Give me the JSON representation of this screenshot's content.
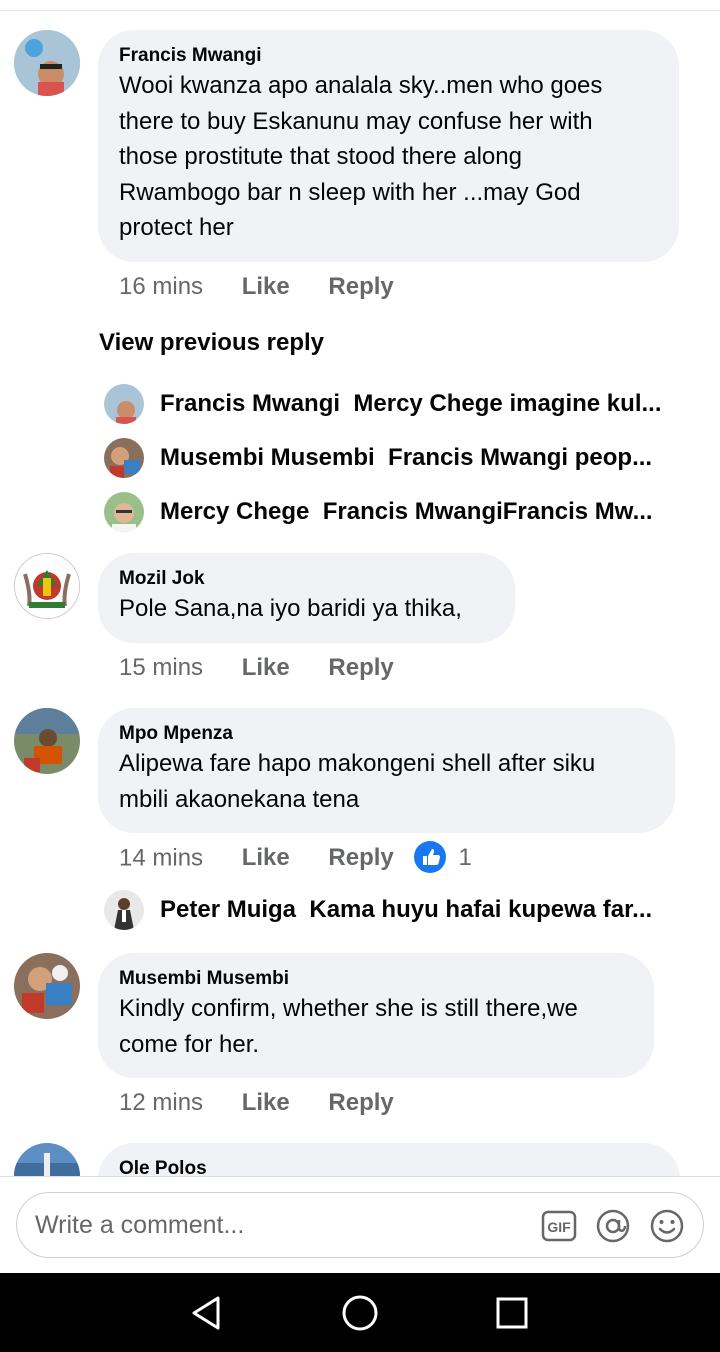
{
  "comments": [
    {
      "author": "Francis Mwangi",
      "lines": [
        "Wooi kwanza apo analala sky..men who goes",
        "there to buy Eskanunu may confuse her with",
        "those prostitute that stood there along",
        "Rwambogo bar n sleep with her ...may  God",
        "protect her"
      ],
      "time": "16 mins",
      "like": "Like",
      "reply": "Reply"
    },
    {
      "author": "Mozil Jok",
      "lines": [
        "Pole Sana,na iyo baridi ya thika,"
      ],
      "time": "15 mins",
      "like": "Like",
      "reply": "Reply"
    },
    {
      "author": "Mpo Mpenza",
      "lines": [
        "Alipewa fare hapo makongeni shell after siku",
        "mbili akaonekana tena"
      ],
      "time": "14 mins",
      "like": "Like",
      "reply": "Reply",
      "reactions": "1"
    },
    {
      "author": "Musembi Musembi",
      "lines": [
        "Kindly confirm, whether she is still there,we",
        "come for her."
      ],
      "time": "12 mins",
      "like": "Like",
      "reply": "Reply"
    },
    {
      "author": "Ole Polos"
    }
  ],
  "view_previous": "View previous reply",
  "replies_1": [
    {
      "name": "Francis Mwangi",
      "text": "Mercy Chege imagine kul..."
    },
    {
      "name": "Musembi Musembi",
      "text": "Francis Mwangi peop..."
    },
    {
      "name": "Mercy Chege",
      "text": "Francis MwangiFrancis Mw..."
    }
  ],
  "replies_3": [
    {
      "name": "Peter Muiga",
      "text": "Kama huyu hafai kupewa far..."
    }
  ],
  "composer": {
    "placeholder": "Write a comment...",
    "gif_label": "GIF"
  },
  "icons": [
    "gif-icon",
    "mention-icon",
    "emoji-icon",
    "back-icon",
    "home-icon",
    "recents-icon",
    "like-reaction-icon"
  ],
  "colors": {
    "bubble": "#f0f2f5",
    "meta": "#65676b",
    "like_blue": "#1877f2"
  }
}
